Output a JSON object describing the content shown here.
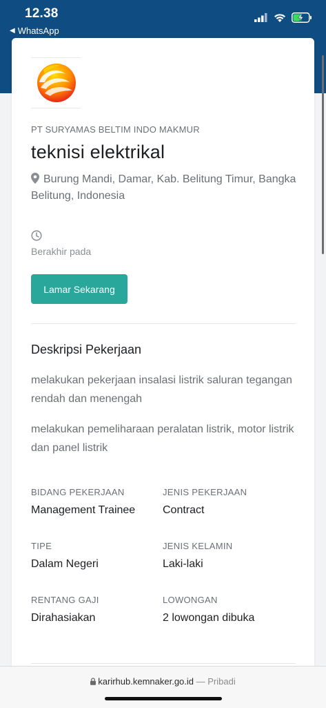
{
  "status": {
    "time": "12.38",
    "back_app": "WhatsApp"
  },
  "job": {
    "company": "PT SURYAMAS BELTIM INDO MAKMUR",
    "title": "teknisi elektrikal",
    "location": "Burung Mandi, Damar, Kab. Belitung Timur, Bangka Belitung, Indonesia",
    "ends_label": "Berakhir pada",
    "apply_label": "Lamar Sekarang"
  },
  "description": {
    "heading": "Deskripsi Pekerjaan",
    "paragraphs": [
      "melakukan pekerjaan insalasi listrik saluran tegangan rendah dan menengah",
      "melakukan pemeliharaan peralatan listrik, motor listrik dan panel listrik"
    ]
  },
  "attributes": [
    {
      "label": "BIDANG PEKERJAAN",
      "value": "Management Trainee"
    },
    {
      "label": "JENIS PEKERJAAN",
      "value": "Contract"
    },
    {
      "label": "TIPE",
      "value": "Dalam Negeri"
    },
    {
      "label": "JENIS KELAMIN",
      "value": "Laki-laki"
    },
    {
      "label": "RENTANG GAJI",
      "value": "Dirahasiakan"
    },
    {
      "label": "LOWONGAN",
      "value": "2 lowongan dibuka"
    }
  ],
  "browser": {
    "url": "karirhub.kemnaker.go.id",
    "mode": "— Pribadi"
  },
  "colors": {
    "header": "#0f4c81",
    "accent": "#2aa79b"
  },
  "icons": [
    "back-arrow-icon",
    "signal-icon",
    "wifi-icon",
    "battery-charging-icon",
    "company-logo",
    "location-pin-icon",
    "clock-icon",
    "lock-icon"
  ]
}
